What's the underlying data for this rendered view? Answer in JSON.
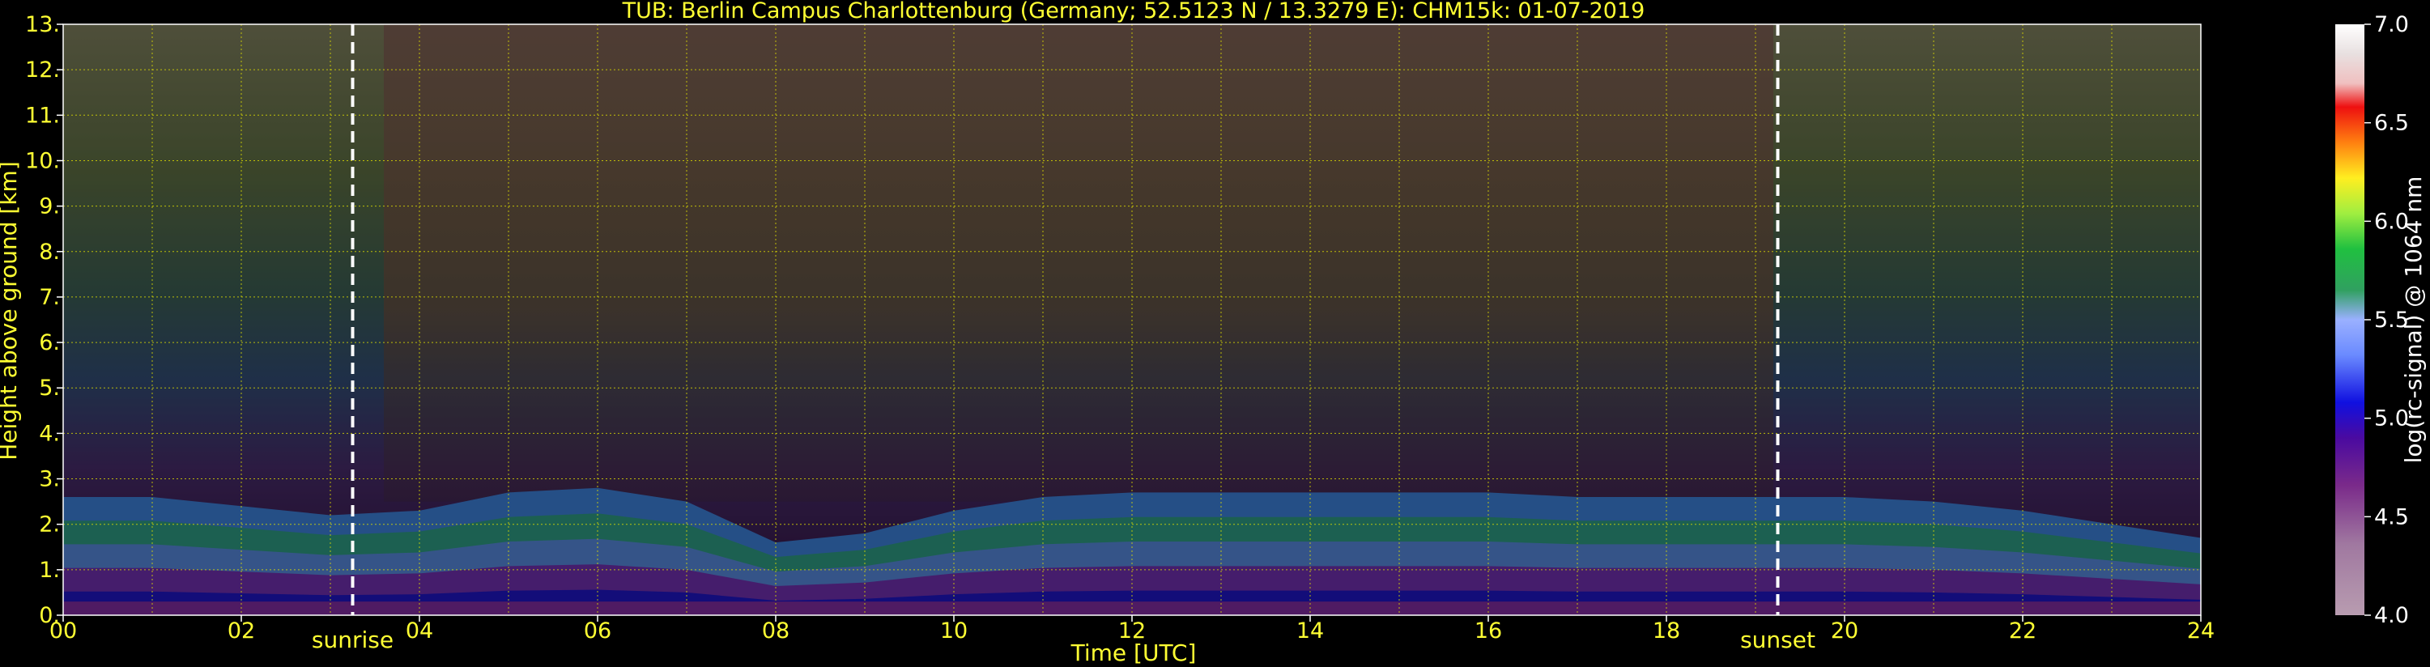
{
  "chart_data": {
    "type": "heatmap",
    "title": "TUB: Berlin Campus Charlottenburg (Germany; 52.5123 N / 13.3279 E):    CHM15k: 01-07-2019",
    "xlabel": "Time [UTC]",
    "ylabel": "Height above ground [km]",
    "xlim": [
      0,
      24
    ],
    "ylim": [
      0,
      13
    ],
    "x_ticks": [
      "00",
      "02",
      "04",
      "06",
      "08",
      "10",
      "12",
      "14",
      "16",
      "18",
      "20",
      "22",
      "24"
    ],
    "y_ticks": [
      "0.",
      "1.",
      "2.",
      "3.",
      "4.",
      "5.",
      "6.",
      "7.",
      "8.",
      "9.",
      "10.",
      "11.",
      "12.",
      "13."
    ],
    "grid": true,
    "markers": [
      {
        "label": "sunrise",
        "x": 3.25
      },
      {
        "label": "sunset",
        "x": 19.25
      }
    ],
    "colorbar": {
      "label": "log(rc-signal) @ 1064 nm",
      "range": [
        4.0,
        7.0
      ],
      "ticks": [
        "4.0",
        "4.5",
        "5.0",
        "5.5",
        "6.0",
        "6.5",
        "7.0"
      ]
    },
    "colors": {
      "text": "#ffff33",
      "grid": "#e0e000",
      "marker": "#ffffff"
    },
    "layers": {
      "boundary_layer_top_km": [
        2.6,
        2.6,
        2.4,
        2.2,
        2.3,
        2.7,
        2.8,
        2.5,
        1.6,
        1.8,
        2.3,
        2.6,
        2.7,
        2.7,
        2.7,
        2.7,
        2.7,
        2.6,
        2.6,
        2.6,
        2.6,
        2.5,
        2.3,
        2.0,
        1.7
      ],
      "hours": [
        0,
        1,
        2,
        3,
        4,
        5,
        6,
        7,
        8,
        9,
        10,
        11,
        12,
        13,
        14,
        15,
        16,
        17,
        18,
        19,
        20,
        21,
        22,
        23,
        24
      ]
    }
  }
}
